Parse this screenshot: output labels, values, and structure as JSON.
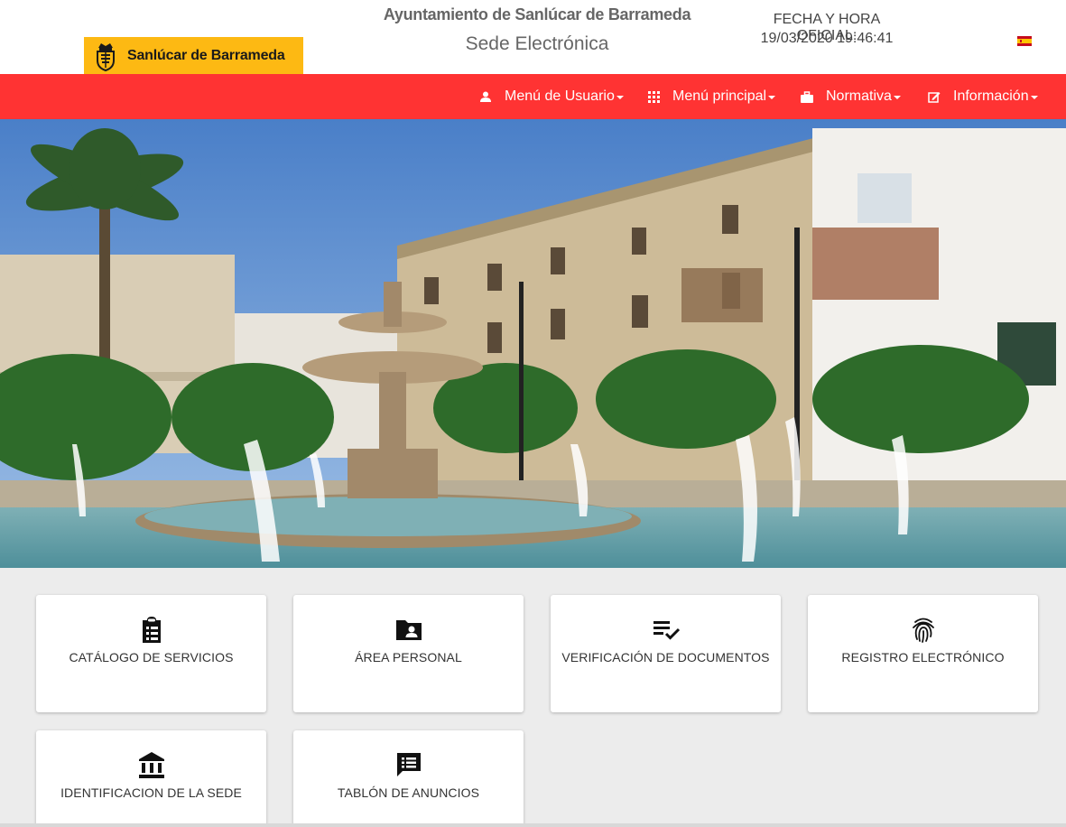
{
  "header": {
    "logo_text": "Sanlúcar de Barrameda",
    "org_title": "Ayuntamiento de Sanlúcar de Barrameda",
    "sede_title": "Sede Electrónica",
    "fecha_label": "FECHA Y HORA OFICIAL:",
    "fecha_value": "19/03/2020  19:46:41",
    "language_flag": "spain-flag-icon"
  },
  "nav": {
    "items": [
      {
        "label": "Menú de Usuario",
        "icon": "user-icon"
      },
      {
        "label": "Menú principal",
        "icon": "grid-icon"
      },
      {
        "label": "Normativa",
        "icon": "briefcase-icon"
      },
      {
        "label": "Información",
        "icon": "edit-icon"
      }
    ]
  },
  "hero": {
    "description_icon": "town-square-fountain-photo"
  },
  "cards": [
    {
      "label": "CATÁLOGO DE SERVICIOS",
      "icon": "clipboard-icon"
    },
    {
      "label": "ÁREA PERSONAL",
      "icon": "folder-user-icon"
    },
    {
      "label": "VERIFICACIÓN DE DOCUMENTOS",
      "icon": "checklist-icon"
    },
    {
      "label": "REGISTRO ELECTRÓNICO",
      "icon": "fingerprint-icon"
    },
    {
      "label": "IDENTIFICACION DE LA SEDE",
      "icon": "institution-icon"
    },
    {
      "label": "TABLÓN DE ANUNCIOS",
      "icon": "announcement-icon"
    }
  ],
  "colors": {
    "navbar": "#ff3333",
    "logo_bg": "#fdb913",
    "page_bg": "#ececec"
  }
}
